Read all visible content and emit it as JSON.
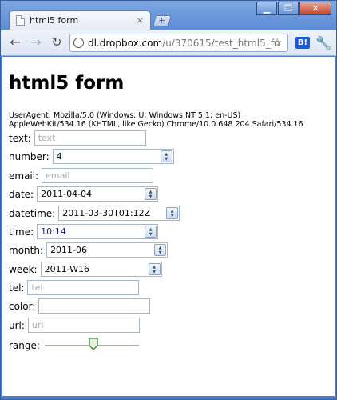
{
  "browser": {
    "tab_title": "html5 form",
    "tab_close": "×",
    "newtab_label": "+",
    "url_host": "dl.dropbox.com",
    "url_path": "/u/370615/test_html5_fo",
    "back_icon": "back-arrow-icon",
    "forward_icon": "forward-arrow-icon",
    "reload_icon": "reload-icon",
    "bookmark_icon": "star-icon",
    "hatena_label": "B!",
    "wrench_icon": "wrench-icon",
    "window_buttons": [
      "minimize",
      "maximize",
      "close"
    ]
  },
  "page": {
    "heading": "html5 form",
    "user_agent_line1": "UserAgent: Mozilla/5.0 (Windows; U; Windows NT 5.1; en-US)",
    "user_agent_line2": "AppleWebKit/534.16 (KHTML, like Gecko) Chrome/10.0.648.204 Safari/534.16"
  },
  "form": {
    "text": {
      "label": "text:",
      "placeholder": "text"
    },
    "number": {
      "label": "number:",
      "value": "4"
    },
    "email": {
      "label": "email:",
      "placeholder": "email"
    },
    "date": {
      "label": "date:",
      "value": "2011-04-04"
    },
    "datetime": {
      "label": "datetime:",
      "value": "2011-03-30T01:12Z"
    },
    "time": {
      "label": "time:",
      "value": "10:14"
    },
    "month": {
      "label": "month:",
      "value": "2011-06"
    },
    "week": {
      "label": "week:",
      "value": "2011-W16"
    },
    "tel": {
      "label": "tel:",
      "placeholder": "tel"
    },
    "color": {
      "label": "color:",
      "value": ""
    },
    "url": {
      "label": "url:",
      "placeholder": "url"
    },
    "range": {
      "label": "range:",
      "value_fraction": 0.5
    }
  }
}
